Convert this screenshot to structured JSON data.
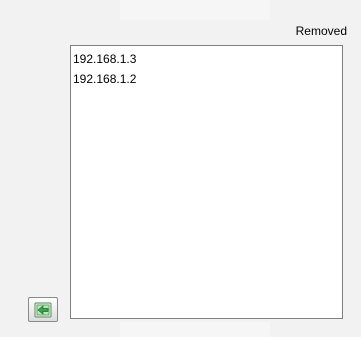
{
  "header": {
    "removed_label": "Removed"
  },
  "removed_list": {
    "items": [
      {
        "label": "192.168.1.3"
      },
      {
        "label": "192.168.1.2"
      }
    ]
  },
  "controls": {
    "move_left_icon": "arrow-left-icon"
  },
  "colors": {
    "background": "#f2f2f2",
    "list_background": "#ffffff",
    "list_border": "#7f7f7f",
    "icon_green": "#3aa64a"
  }
}
